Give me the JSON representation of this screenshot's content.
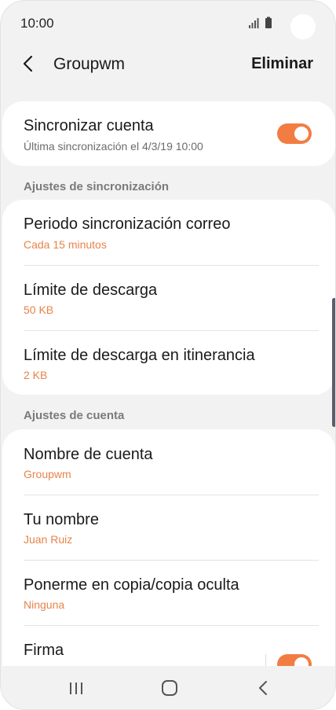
{
  "status_bar": {
    "time": "10:00",
    "icons": [
      "signal-icon",
      "battery-icon"
    ]
  },
  "header": {
    "back_icon": "back-arrow-icon",
    "title": "Groupwm",
    "action_label": "Eliminar"
  },
  "sync_account": {
    "title": "Sincronizar cuenta",
    "subtitle": "Última sincronización el 4/3/19  10:00",
    "toggle_on": true
  },
  "sync_settings": {
    "header": "Ajustes de sincronización",
    "items": [
      {
        "title": "Periodo sincronización correo",
        "value": "Cada 15 minutos"
      },
      {
        "title": "Límite de descarga",
        "value": "50 KB"
      },
      {
        "title": "Límite de descarga en itinerancia",
        "value": "2 KB"
      }
    ]
  },
  "account_settings": {
    "header": "Ajustes de cuenta",
    "items": [
      {
        "title": "Nombre de cuenta",
        "value": "Groupwm"
      },
      {
        "title": "Tu nombre",
        "value": "Juan Ruiz"
      },
      {
        "title": "Ponerme en copia/copia oculta",
        "value": "Ninguna"
      },
      {
        "title": "Firma",
        "toggle_on": true
      }
    ]
  },
  "navbar": {
    "icons": [
      "recent-apps-icon",
      "home-icon",
      "back-icon"
    ]
  },
  "colors": {
    "accent": "#f27d43",
    "value_text": "#e8834a",
    "background": "#f2f2f2",
    "card": "#ffffff",
    "scrollbar": "#5d5d6b"
  }
}
